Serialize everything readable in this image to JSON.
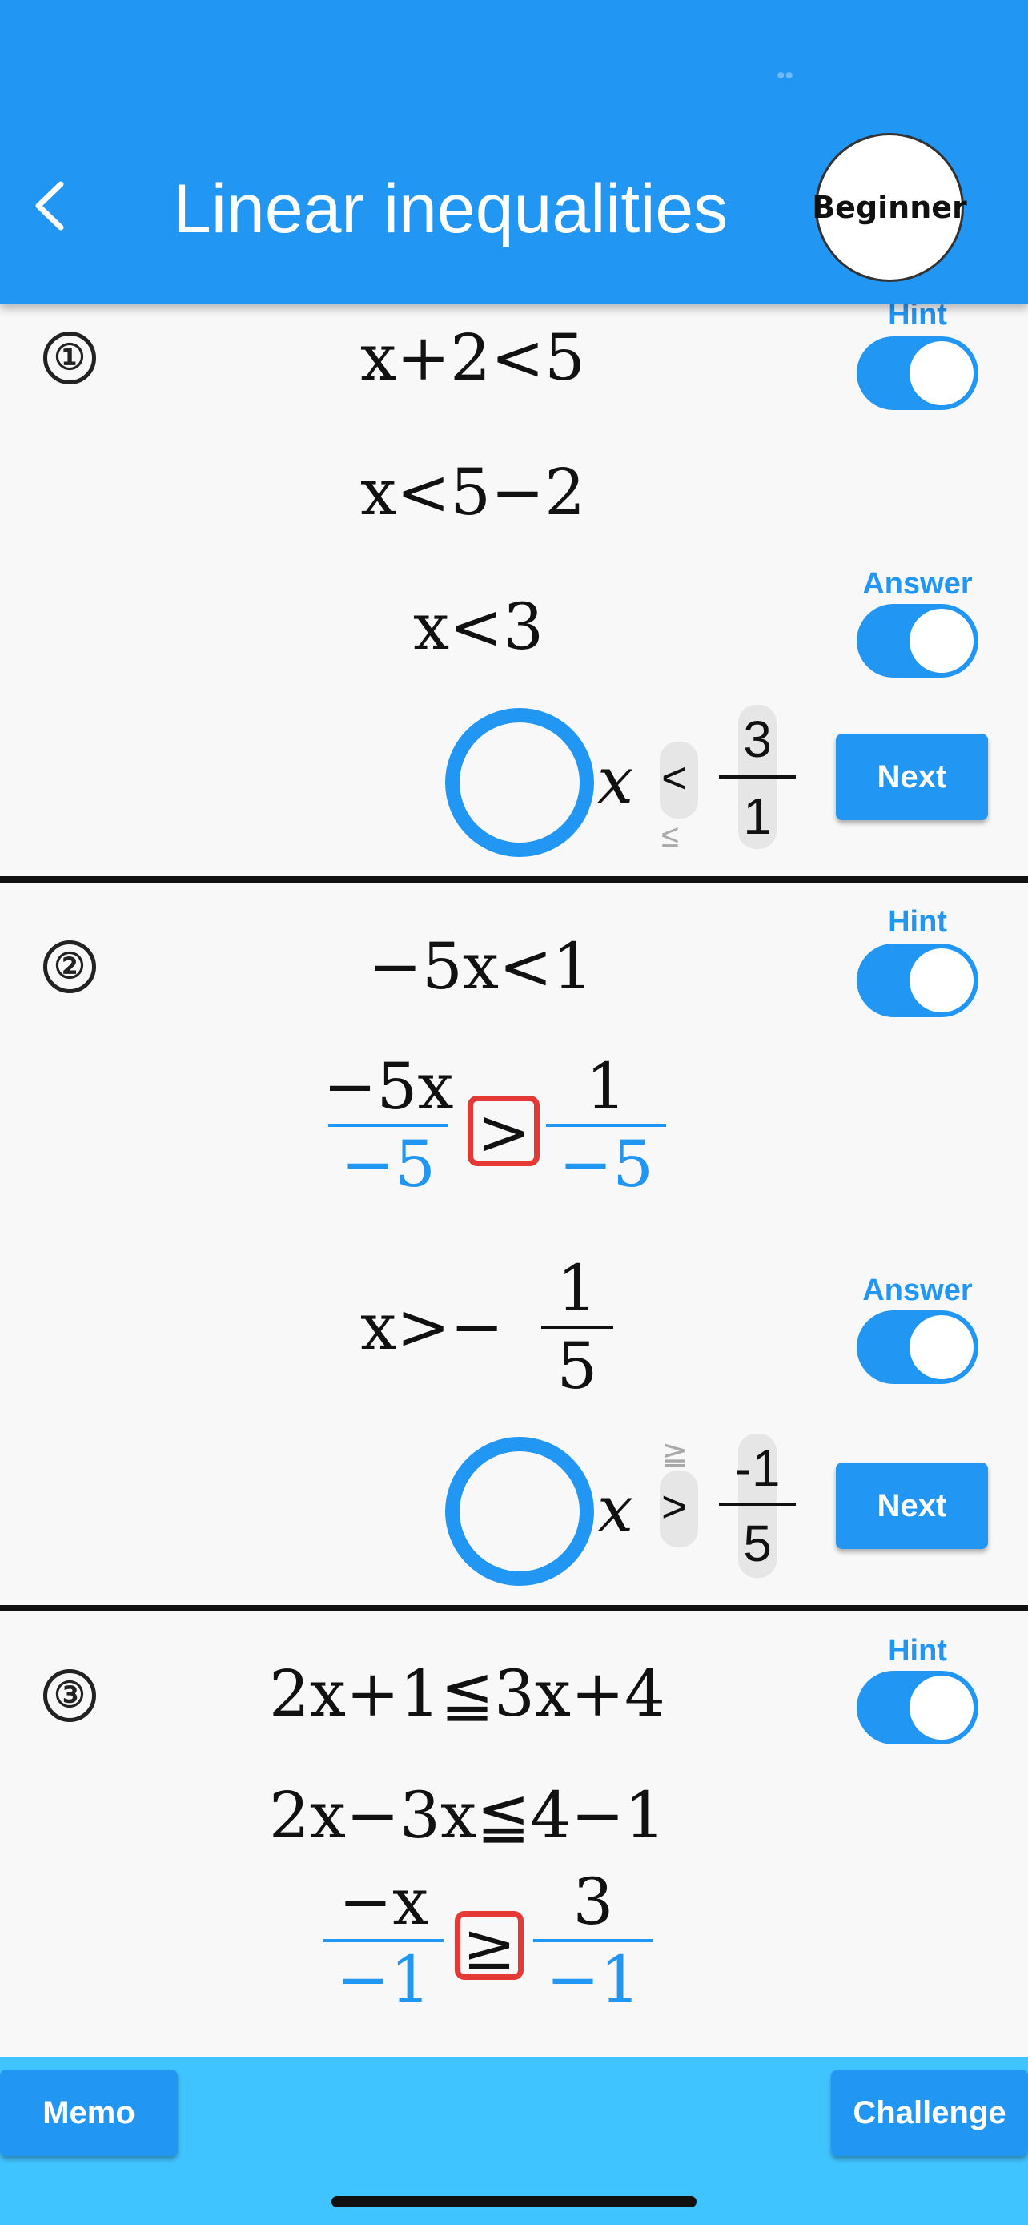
{
  "header": {
    "title": "Linear inequalities",
    "level_badge": "Beginner",
    "back_icon": "chevron-left-icon",
    "indicator": "••",
    "color": "#2196f3"
  },
  "problems": [
    {
      "number": "①",
      "steps": [
        "x+2<5",
        "x<5−2",
        "x<3"
      ],
      "hint_label": "Hint",
      "answer_label": "Answer",
      "answer": {
        "var": "x",
        "symbol": "<",
        "symbol_alt": "≤",
        "numerator": "3",
        "denominator": "1"
      },
      "next_label": "Next"
    },
    {
      "number": "②",
      "steps": [
        "−5x<1",
        "x>−"
      ],
      "fraction_step": {
        "left_top": "−5x",
        "left_bottom": "−5",
        "symbol": ">",
        "right_top": "1",
        "right_bottom": "−5"
      },
      "final_fraction": {
        "top": "1",
        "bottom": "5"
      },
      "hint_label": "Hint",
      "answer_label": "Answer",
      "answer": {
        "var": "x",
        "symbol": ">",
        "symbol_alt": "≧",
        "numerator": "-1",
        "denominator": "5"
      },
      "next_label": "Next"
    },
    {
      "number": "③",
      "steps": [
        "2x+1≦3x+4",
        "2x−3x≦4−1"
      ],
      "fraction_step": {
        "left_top": "−x",
        "left_bottom": "−1",
        "symbol": "≥",
        "right_top": "3",
        "right_bottom": "−1"
      },
      "hint_label": "Hint"
    }
  ],
  "footer": {
    "memo_label": "Memo",
    "challenge_label": "Challenge",
    "color": "#40c4ff"
  }
}
